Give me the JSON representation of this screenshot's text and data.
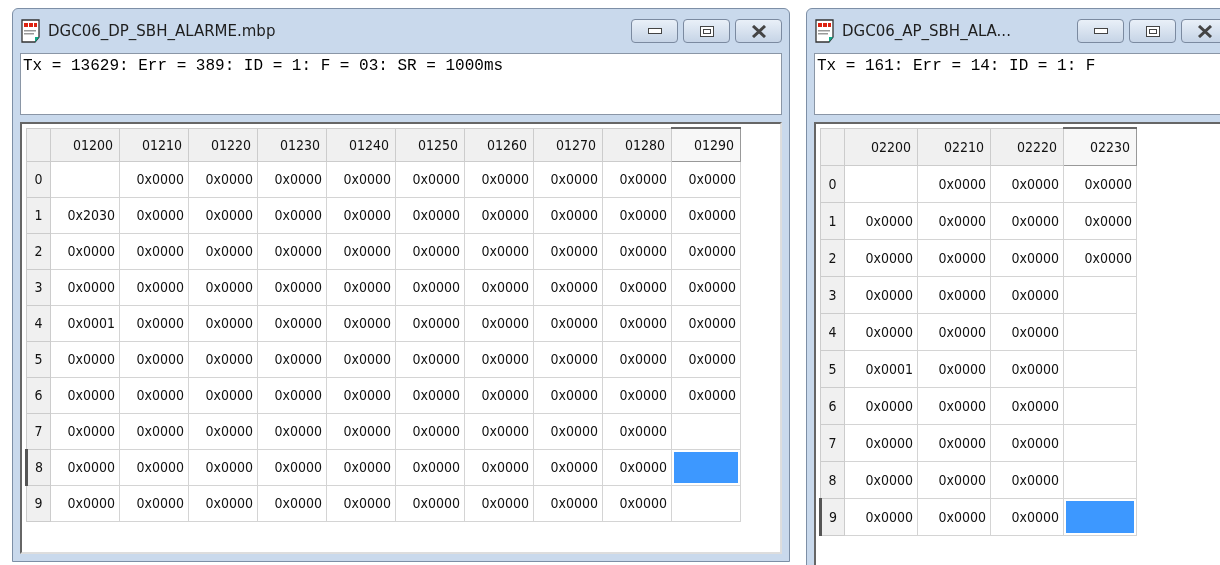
{
  "windows": [
    {
      "title": "DGC06_DP_SBH_ALARME.mbp",
      "status": "Tx = 13629: Err = 389: ID = 1: F = 03: SR = 1000ms",
      "grid": {
        "columns": [
          "01200",
          "01210",
          "01220",
          "01230",
          "01240",
          "01250",
          "01260",
          "01270",
          "01280",
          "01290"
        ],
        "rows": [
          {
            "label": "0",
            "cells": [
              {
                "selected": false
              },
              {
                "value": "0x0000",
                "selected": false
              },
              {
                "value": "0x0000",
                "selected": false
              },
              {
                "value": "0x0000",
                "selected": false
              },
              {
                "value": "0x0000",
                "selected": false
              },
              {
                "value": "0x0000",
                "selected": false
              },
              {
                "value": "0x0000",
                "selected": false
              },
              {
                "value": "0x0000",
                "selected": false
              },
              {
                "value": "0x0000",
                "selected": false
              },
              {
                "value": "0x0000",
                "selected": false
              }
            ]
          },
          {
            "label": "1",
            "cells": [
              {
                "value": "0x2030",
                "selected": false
              },
              {
                "value": "0x0000",
                "selected": false
              },
              {
                "value": "0x0000",
                "selected": false
              },
              {
                "value": "0x0000",
                "selected": false
              },
              {
                "value": "0x0000",
                "selected": false
              },
              {
                "value": "0x0000",
                "selected": false
              },
              {
                "value": "0x0000",
                "selected": false
              },
              {
                "value": "0x0000",
                "selected": false
              },
              {
                "value": "0x0000",
                "selected": false
              },
              {
                "value": "0x0000",
                "selected": false
              }
            ]
          },
          {
            "label": "2",
            "cells": [
              {
                "value": "0x0000",
                "selected": false
              },
              {
                "value": "0x0000",
                "selected": false
              },
              {
                "value": "0x0000",
                "selected": false
              },
              {
                "value": "0x0000",
                "selected": false
              },
              {
                "value": "0x0000",
                "selected": false
              },
              {
                "value": "0x0000",
                "selected": false
              },
              {
                "value": "0x0000",
                "selected": false
              },
              {
                "value": "0x0000",
                "selected": false
              },
              {
                "value": "0x0000",
                "selected": false
              },
              {
                "value": "0x0000",
                "selected": false
              }
            ]
          },
          {
            "label": "3",
            "cells": [
              {
                "value": "0x0000",
                "selected": false
              },
              {
                "value": "0x0000",
                "selected": false
              },
              {
                "value": "0x0000",
                "selected": false
              },
              {
                "value": "0x0000",
                "selected": false
              },
              {
                "value": "0x0000",
                "selected": false
              },
              {
                "value": "0x0000",
                "selected": false
              },
              {
                "value": "0x0000",
                "selected": false
              },
              {
                "value": "0x0000",
                "selected": false
              },
              {
                "value": "0x0000",
                "selected": false
              },
              {
                "value": "0x0000",
                "selected": false
              }
            ]
          },
          {
            "label": "4",
            "cells": [
              {
                "value": "0x0001",
                "selected": false
              },
              {
                "value": "0x0000",
                "selected": false
              },
              {
                "value": "0x0000",
                "selected": false
              },
              {
                "value": "0x0000",
                "selected": false
              },
              {
                "value": "0x0000",
                "selected": false
              },
              {
                "value": "0x0000",
                "selected": false
              },
              {
                "value": "0x0000",
                "selected": false
              },
              {
                "value": "0x0000",
                "selected": false
              },
              {
                "value": "0x0000",
                "selected": false
              },
              {
                "value": "0x0000",
                "selected": false
              }
            ]
          },
          {
            "label": "5",
            "cells": [
              {
                "value": "0x0000",
                "selected": false
              },
              {
                "value": "0x0000",
                "selected": false
              },
              {
                "value": "0x0000",
                "selected": false
              },
              {
                "value": "0x0000",
                "selected": false
              },
              {
                "value": "0x0000",
                "selected": false
              },
              {
                "value": "0x0000",
                "selected": false
              },
              {
                "value": "0x0000",
                "selected": false
              },
              {
                "value": "0x0000",
                "selected": false
              },
              {
                "value": "0x0000",
                "selected": false
              },
              {
                "value": "0x0000",
                "selected": false
              }
            ]
          },
          {
            "label": "6",
            "cells": [
              {
                "value": "0x0000",
                "selected": false
              },
              {
                "value": "0x0000",
                "selected": false
              },
              {
                "value": "0x0000",
                "selected": false
              },
              {
                "value": "0x0000",
                "selected": false
              },
              {
                "value": "0x0000",
                "selected": false
              },
              {
                "value": "0x0000",
                "selected": false
              },
              {
                "value": "0x0000",
                "selected": false
              },
              {
                "value": "0x0000",
                "selected": false
              },
              {
                "value": "0x0000",
                "selected": false
              },
              {
                "value": "0x0000",
                "selected": false
              }
            ]
          },
          {
            "label": "7",
            "cells": [
              {
                "value": "0x0000",
                "selected": false
              },
              {
                "value": "0x0000",
                "selected": false
              },
              {
                "value": "0x0000",
                "selected": false
              },
              {
                "value": "0x0000",
                "selected": false
              },
              {
                "value": "0x0000",
                "selected": false
              },
              {
                "value": "0x0000",
                "selected": false
              },
              {
                "value": "0x0000",
                "selected": false
              },
              {
                "value": "0x0000",
                "selected": false
              },
              {
                "value": "0x0000",
                "selected": false
              },
              {
                "selected": false
              }
            ]
          },
          {
            "label": "8",
            "cells": [
              {
                "value": "0x0000",
                "selected": false
              },
              {
                "value": "0x0000",
                "selected": false
              },
              {
                "value": "0x0000",
                "selected": false
              },
              {
                "value": "0x0000",
                "selected": false
              },
              {
                "value": "0x0000",
                "selected": false
              },
              {
                "value": "0x0000",
                "selected": false
              },
              {
                "value": "0x0000",
                "selected": false
              },
              {
                "value": "0x0000",
                "selected": false
              },
              {
                "value": "0x0000",
                "selected": false
              },
              {
                "selected": true
              }
            ]
          },
          {
            "label": "9",
            "cells": [
              {
                "value": "0x0000",
                "selected": false
              },
              {
                "value": "0x0000",
                "selected": false
              },
              {
                "value": "0x0000",
                "selected": false
              },
              {
                "value": "0x0000",
                "selected": false
              },
              {
                "value": "0x0000",
                "selected": false
              },
              {
                "value": "0x0000",
                "selected": false
              },
              {
                "value": "0x0000",
                "selected": false
              },
              {
                "value": "0x0000",
                "selected": false
              },
              {
                "value": "0x0000",
                "selected": false
              },
              {
                "selected": false
              }
            ]
          }
        ]
      }
    },
    {
      "title": "DGC06_AP_SBH_ALA...",
      "status": "Tx = 161: Err = 14: ID = 1: F",
      "grid": {
        "columns": [
          "02200",
          "02210",
          "02220",
          "02230"
        ],
        "rows": [
          {
            "label": "0",
            "cells": [
              {
                "selected": false
              },
              {
                "value": "0x0000",
                "selected": false
              },
              {
                "value": "0x0000",
                "selected": false
              },
              {
                "value": "0x0000",
                "selected": false
              }
            ]
          },
          {
            "label": "1",
            "cells": [
              {
                "value": "0x0000",
                "selected": false
              },
              {
                "value": "0x0000",
                "selected": false
              },
              {
                "value": "0x0000",
                "selected": false
              },
              {
                "value": "0x0000",
                "selected": false
              }
            ]
          },
          {
            "label": "2",
            "cells": [
              {
                "value": "0x0000",
                "selected": false
              },
              {
                "value": "0x0000",
                "selected": false
              },
              {
                "value": "0x0000",
                "selected": false
              },
              {
                "value": "0x0000",
                "selected": false
              }
            ]
          },
          {
            "label": "3",
            "cells": [
              {
                "value": "0x0000",
                "selected": false
              },
              {
                "value": "0x0000",
                "selected": false
              },
              {
                "value": "0x0000",
                "selected": false
              },
              {
                "selected": false
              }
            ]
          },
          {
            "label": "4",
            "cells": [
              {
                "value": "0x0000",
                "selected": false
              },
              {
                "value": "0x0000",
                "selected": false
              },
              {
                "value": "0x0000",
                "selected": false
              },
              {
                "selected": false
              }
            ]
          },
          {
            "label": "5",
            "cells": [
              {
                "value": "0x0001",
                "selected": false
              },
              {
                "value": "0x0000",
                "selected": false
              },
              {
                "value": "0x0000",
                "selected": false
              },
              {
                "selected": false
              }
            ]
          },
          {
            "label": "6",
            "cells": [
              {
                "value": "0x0000",
                "selected": false
              },
              {
                "value": "0x0000",
                "selected": false
              },
              {
                "value": "0x0000",
                "selected": false
              },
              {
                "selected": false
              }
            ]
          },
          {
            "label": "7",
            "cells": [
              {
                "value": "0x0000",
                "selected": false
              },
              {
                "value": "0x0000",
                "selected": false
              },
              {
                "value": "0x0000",
                "selected": false
              },
              {
                "selected": false
              }
            ]
          },
          {
            "label": "8",
            "cells": [
              {
                "value": "0x0000",
                "selected": false
              },
              {
                "value": "0x0000",
                "selected": false
              },
              {
                "value": "0x0000",
                "selected": false
              },
              {
                "selected": false
              }
            ]
          },
          {
            "label": "9",
            "cells": [
              {
                "value": "0x0000",
                "selected": false
              },
              {
                "value": "0x0000",
                "selected": false
              },
              {
                "value": "0x0000",
                "selected": false
              },
              {
                "selected": true
              }
            ]
          }
        ]
      }
    }
  ]
}
